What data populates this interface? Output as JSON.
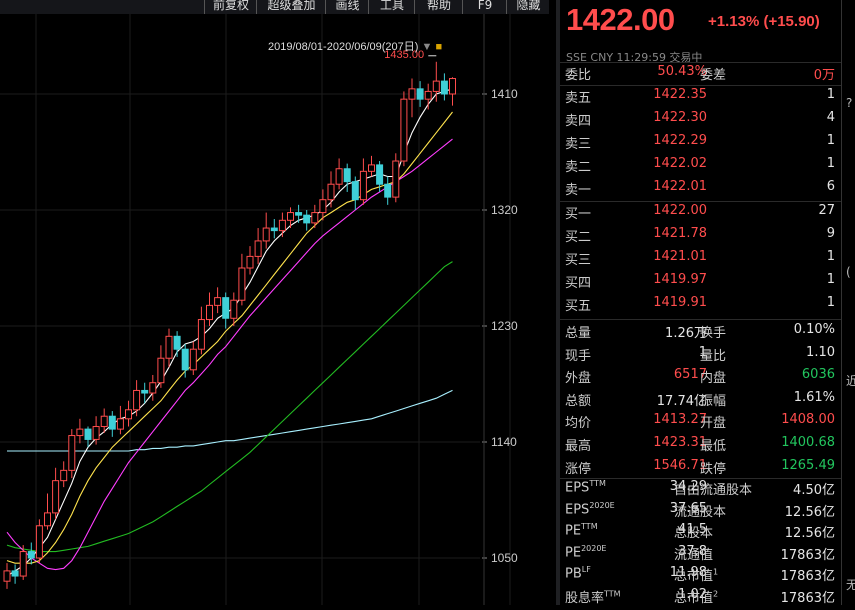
{
  "toolbar": {
    "items": [
      "前复权",
      "超级叠加",
      "画线",
      "工具",
      "帮助",
      "F9",
      "隐藏"
    ]
  },
  "chart": {
    "range_label": "2019/08/01-2020/06/09(207日)",
    "max_label": "1435.00",
    "y_ticks": [
      "1410",
      "1320",
      "1230",
      "1140",
      "1050"
    ],
    "colors": {
      "up": "#ff4d4d",
      "down": "#3fd0d8",
      "ma5": "#ffffff",
      "ma10": "#ffe34d",
      "ma20": "#ff3dff",
      "ma60": "#22bb22",
      "ma120": "#a8f0ff"
    }
  },
  "chart_data": {
    "type": "line",
    "title": "",
    "ylim": [
      1030,
      1440
    ],
    "candles": [
      [
        1032,
        1040,
        1026,
        1046
      ],
      [
        1040,
        1036,
        1030,
        1045
      ],
      [
        1036,
        1055,
        1033,
        1060
      ],
      [
        1055,
        1050,
        1045,
        1062
      ],
      [
        1050,
        1075,
        1046,
        1080
      ],
      [
        1075,
        1085,
        1072,
        1100
      ],
      [
        1085,
        1110,
        1080,
        1120
      ],
      [
        1110,
        1118,
        1105,
        1125
      ],
      [
        1118,
        1145,
        1112,
        1150
      ],
      [
        1145,
        1150,
        1139,
        1158
      ],
      [
        1150,
        1142,
        1136,
        1152
      ],
      [
        1142,
        1152,
        1138,
        1160
      ],
      [
        1152,
        1160,
        1147,
        1166
      ],
      [
        1160,
        1150,
        1144,
        1164
      ],
      [
        1150,
        1158,
        1146,
        1168
      ],
      [
        1158,
        1165,
        1152,
        1172
      ],
      [
        1165,
        1180,
        1160,
        1188
      ],
      [
        1180,
        1178,
        1170,
        1186
      ],
      [
        1178,
        1186,
        1172,
        1192
      ],
      [
        1186,
        1205,
        1182,
        1215
      ],
      [
        1205,
        1222,
        1198,
        1228
      ],
      [
        1222,
        1212,
        1206,
        1226
      ],
      [
        1212,
        1196,
        1190,
        1216
      ],
      [
        1196,
        1212,
        1192,
        1218
      ],
      [
        1212,
        1235,
        1208,
        1245
      ],
      [
        1235,
        1246,
        1230,
        1256
      ],
      [
        1246,
        1252,
        1240,
        1260
      ],
      [
        1252,
        1236,
        1228,
        1256
      ],
      [
        1236,
        1250,
        1230,
        1256
      ],
      [
        1250,
        1275,
        1246,
        1286
      ],
      [
        1275,
        1284,
        1270,
        1292
      ],
      [
        1284,
        1296,
        1278,
        1306
      ],
      [
        1296,
        1306,
        1290,
        1318
      ],
      [
        1306,
        1304,
        1298,
        1313
      ],
      [
        1304,
        1312,
        1299,
        1318
      ],
      [
        1312,
        1318,
        1306,
        1322
      ],
      [
        1318,
        1316,
        1310,
        1324
      ],
      [
        1316,
        1310,
        1304,
        1320
      ],
      [
        1310,
        1318,
        1306,
        1324
      ],
      [
        1318,
        1328,
        1312,
        1336
      ],
      [
        1328,
        1340,
        1322,
        1350
      ],
      [
        1340,
        1352,
        1336,
        1360
      ],
      [
        1352,
        1342,
        1334,
        1356
      ],
      [
        1342,
        1328,
        1320,
        1346
      ],
      [
        1328,
        1350,
        1324,
        1360
      ],
      [
        1350,
        1355,
        1346,
        1362
      ],
      [
        1355,
        1340,
        1334,
        1358
      ],
      [
        1340,
        1330,
        1324,
        1346
      ],
      [
        1330,
        1358,
        1326,
        1364
      ],
      [
        1358,
        1406,
        1354,
        1412
      ],
      [
        1406,
        1414,
        1392,
        1422
      ],
      [
        1414,
        1406,
        1400,
        1420
      ],
      [
        1406,
        1412,
        1398,
        1418
      ],
      [
        1412,
        1420,
        1404,
        1435
      ],
      [
        1420,
        1410,
        1405,
        1426
      ],
      [
        1410,
        1422,
        1401,
        1423
      ]
    ],
    "ma5": [
      1036,
      1040,
      1044,
      1050,
      1058,
      1066,
      1080,
      1094,
      1108,
      1125,
      1136,
      1143,
      1148,
      1154,
      1158,
      1160,
      1164,
      1170,
      1178,
      1187,
      1198,
      1210,
      1216,
      1218,
      1222,
      1228,
      1236,
      1240,
      1244,
      1254,
      1264,
      1276,
      1288,
      1296,
      1302,
      1308,
      1312,
      1314,
      1316,
      1320,
      1326,
      1334,
      1340,
      1342,
      1344,
      1346,
      1348,
      1346,
      1346,
      1364,
      1380,
      1392,
      1402,
      1410,
      1412,
      1414
    ],
    "ma10": [
      1048,
      1046,
      1046,
      1046,
      1048,
      1054,
      1062,
      1072,
      1084,
      1098,
      1110,
      1120,
      1128,
      1136,
      1142,
      1148,
      1154,
      1160,
      1166,
      1172,
      1180,
      1188,
      1195,
      1200,
      1206,
      1212,
      1218,
      1226,
      1232,
      1238,
      1246,
      1254,
      1262,
      1270,
      1278,
      1286,
      1294,
      1302,
      1308,
      1314,
      1318,
      1322,
      1326,
      1328,
      1332,
      1336,
      1338,
      1340,
      1342,
      1348,
      1356,
      1364,
      1372,
      1380,
      1388,
      1396
    ],
    "ma20": [
      1070,
      1062,
      1056,
      1050,
      1046,
      1042,
      1041,
      1042,
      1048,
      1058,
      1070,
      1082,
      1094,
      1104,
      1114,
      1124,
      1132,
      1140,
      1148,
      1156,
      1164,
      1172,
      1180,
      1186,
      1193,
      1200,
      1208,
      1214,
      1222,
      1230,
      1238,
      1245,
      1252,
      1259,
      1266,
      1273,
      1280,
      1287,
      1294,
      1300,
      1305,
      1310,
      1315,
      1320,
      1325,
      1330,
      1334,
      1338,
      1342,
      1346,
      1350,
      1355,
      1360,
      1365,
      1370,
      1375
    ],
    "ma60": [
      1060,
      1058,
      1057,
      1056,
      1055,
      1055,
      1055,
      1056,
      1057,
      1058,
      1059,
      1061,
      1063,
      1065,
      1067,
      1069,
      1072,
      1075,
      1078,
      1082,
      1086,
      1090,
      1094,
      1098,
      1102,
      1107,
      1112,
      1117,
      1122,
      1127,
      1132,
      1138,
      1144,
      1150,
      1156,
      1162,
      1168,
      1174,
      1180,
      1186,
      1192,
      1198,
      1204,
      1210,
      1216,
      1222,
      1228,
      1234,
      1240,
      1246,
      1252,
      1258,
      1264,
      1270,
      1276,
      1280
    ],
    "ma120": [
      1133,
      1133,
      1133,
      1133,
      1133,
      1133,
      1133,
      1133,
      1133,
      1133,
      1133,
      1133,
      1133,
      1133,
      1133,
      1133,
      1134,
      1134,
      1135,
      1135,
      1136,
      1136,
      1137,
      1137,
      1138,
      1139,
      1140,
      1141,
      1141,
      1142,
      1143,
      1144,
      1145,
      1146,
      1147,
      1148,
      1149,
      1150,
      1151,
      1152,
      1153,
      1154,
      1155,
      1156,
      1157,
      1158,
      1160,
      1162,
      1164,
      1166,
      1168,
      1170,
      1172,
      1174,
      1177,
      1180
    ]
  },
  "quote": {
    "price": "1422.00",
    "change": "+1.13%  (+15.90)",
    "meta": "SSE  CNY  11:29:59  交易中",
    "webi_label": "委比",
    "webi_value": "50.43%",
    "weicha_label": "委差",
    "weicha_value": "0万",
    "asks": [
      {
        "label": "卖五",
        "price": "1422.35",
        "vol": "1"
      },
      {
        "label": "卖四",
        "price": "1422.30",
        "vol": "4"
      },
      {
        "label": "卖三",
        "price": "1422.29",
        "vol": "1"
      },
      {
        "label": "卖二",
        "price": "1422.02",
        "vol": "1"
      },
      {
        "label": "卖一",
        "price": "1422.01",
        "vol": "6"
      }
    ],
    "bids": [
      {
        "label": "买一",
        "price": "1422.00",
        "vol": "27"
      },
      {
        "label": "买二",
        "price": "1421.78",
        "vol": "9"
      },
      {
        "label": "买三",
        "price": "1421.01",
        "vol": "1"
      },
      {
        "label": "买四",
        "price": "1419.97",
        "vol": "1"
      },
      {
        "label": "买五",
        "price": "1419.91",
        "vol": "1"
      }
    ],
    "stats": [
      {
        "l1": "总量",
        "v1": "1.26万",
        "c1": "white",
        "l2": "换手",
        "v2": "0.10%",
        "c2": "white"
      },
      {
        "l1": "现手",
        "v1": "1",
        "c1": "white",
        "l2": "量比",
        "v2": "1.10",
        "c2": "white"
      },
      {
        "l1": "外盘",
        "v1": "6517",
        "c1": "red",
        "l2": "内盘",
        "v2": "6036",
        "c2": "green"
      },
      {
        "l1": "总额",
        "v1": "17.74亿",
        "c1": "white",
        "l2": "振幅",
        "v2": "1.61%",
        "c2": "white"
      },
      {
        "l1": "均价",
        "v1": "1413.27",
        "c1": "red",
        "l2": "开盘",
        "v2": "1408.00",
        "c2": "red"
      },
      {
        "l1": "最高",
        "v1": "1423.31",
        "c1": "red",
        "l2": "最低",
        "v2": "1400.68",
        "c2": "green"
      },
      {
        "l1": "涨停",
        "v1": "1546.71",
        "c1": "red",
        "l2": "跌停",
        "v2": "1265.49",
        "c2": "green"
      }
    ],
    "fundamentals": [
      {
        "l1": "EPS",
        "s1": "TTM",
        "v1": "34.29",
        "l2": "自由流通股本",
        "v2": "4.50亿"
      },
      {
        "l1": "EPS",
        "s1": "2020E",
        "v1": "37.65",
        "l2": "流通股本",
        "v2": "12.56亿"
      },
      {
        "l1": "PE",
        "s1": "TTM",
        "v1": "41.5",
        "l2": "总股本",
        "v2": "12.56亿"
      },
      {
        "l1": "PE",
        "s1": "2020E",
        "v1": "37.8",
        "l2": "流通值",
        "v2": "17863亿"
      },
      {
        "l1": "PB",
        "s1": "LF",
        "v1": "11.98",
        "l2": "总市值",
        "s2": "1",
        "v2": "17863亿"
      },
      {
        "l1": "股息率",
        "s1": "TTM",
        "v1": "1.02",
        "l2": "总市值",
        "s2": "2",
        "v2": "17863亿"
      }
    ]
  },
  "edge": {
    "texts": [
      "?",
      "(",
      "近",
      "无"
    ]
  }
}
